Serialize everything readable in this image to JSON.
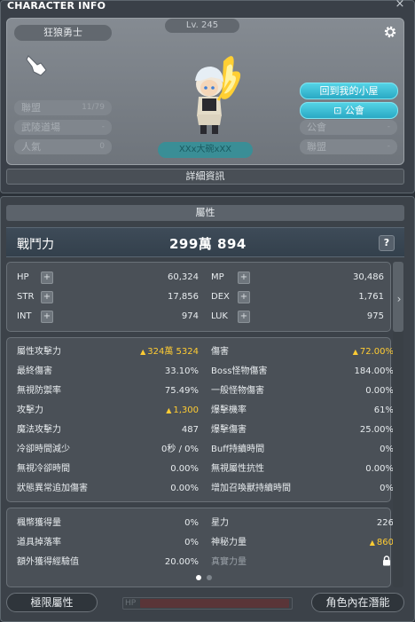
{
  "window": {
    "title": "CHARACTER INFO",
    "close_glyph": "×"
  },
  "profile": {
    "job": "狂狼勇士",
    "level": "Lv. 245",
    "name": "XXx大碗xXX",
    "left_fields": [
      {
        "label": "聯盟",
        "value": "11/79"
      },
      {
        "label": "武陵道場",
        "value": "-"
      },
      {
        "label": "人氣",
        "value": "0"
      }
    ],
    "right_fields": [
      {
        "label": "公會",
        "value": "-"
      },
      {
        "label": "聯盟",
        "value": "-"
      }
    ],
    "home_button": "回到我的小屋",
    "guild_button": "公會",
    "detail_button": "詳細資訊"
  },
  "attributes": {
    "header": "屬性",
    "combat_label": "戰鬥力",
    "combat_value": "299萬 894",
    "help": "?",
    "basic": [
      {
        "label": "HP",
        "value": "60,324",
        "label2": "MP",
        "value2": "30,486"
      },
      {
        "label": "STR",
        "value": "17,856",
        "label2": "DEX",
        "value2": "1,761"
      },
      {
        "label": "INT",
        "value": "974",
        "label2": "LUK",
        "value2": "975"
      }
    ],
    "attack": [
      {
        "label": "屬性攻擊力",
        "value": "324萬 5324",
        "label2": "傷害",
        "value2": "72.00%"
      },
      {
        "label": "最終傷害",
        "value": "33.10%",
        "label2": "Boss怪物傷害",
        "value2": "184.00%"
      },
      {
        "label": "無視防禦率",
        "value": "75.49%",
        "label2": "一般怪物傷害",
        "value2": "0.00%"
      },
      {
        "label": "攻擊力",
        "value": "1,300",
        "label2": "爆擊機率",
        "value2": "61%"
      },
      {
        "label": "魔法攻擊力",
        "value": "487",
        "label2": "爆擊傷害",
        "value2": "25.00%"
      },
      {
        "label": "冷卻時間減少",
        "value": "0秒 / 0%",
        "label2": "Buff持續時間",
        "value2": "0%"
      },
      {
        "label": "無視冷卻時間",
        "value": "0.00%",
        "label2": "無視屬性抗性",
        "value2": "0.00%"
      },
      {
        "label": "狀態異常追加傷害",
        "value": "0.00%",
        "label2": "增加召喚獸持續時間",
        "value2": "0%"
      }
    ],
    "extra": [
      {
        "label": "楓幣獲得量",
        "value": "0%",
        "label2": "星力",
        "value2": "226"
      },
      {
        "label": "道具掉落率",
        "value": "0%",
        "label2": "神秘力量",
        "value2": "860"
      },
      {
        "label": "額外獲得經驗值",
        "value": "20.00%",
        "label2": "真實力量",
        "value2": ""
      }
    ],
    "limit_button": "極限屬性",
    "potential_button": "角色內在潛能",
    "hp_bar_label": "HP"
  },
  "colors": {
    "accent_cyan": "#29a9c4",
    "highlight_yellow": "#ffcc33"
  }
}
